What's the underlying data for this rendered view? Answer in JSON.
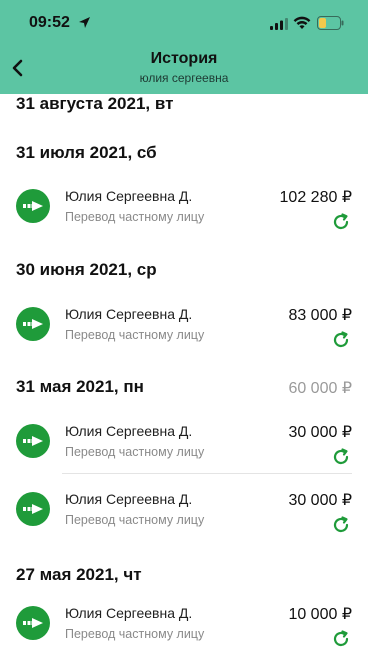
{
  "status_bar": {
    "time": "09:52"
  },
  "header": {
    "title": "История",
    "subtitle": "юлия сергеевна"
  },
  "top_date": "31 августа 2021, вт",
  "sections": [
    {
      "date": "31 июля 2021, сб",
      "total": "",
      "transactions": [
        {
          "name": "Юлия Сергеевна Д.",
          "description": "Перевод частному лицу",
          "amount": "102 280 ₽"
        }
      ]
    },
    {
      "date": "30 июня 2021, ср",
      "total": "",
      "transactions": [
        {
          "name": "Юлия Сергеевна Д.",
          "description": "Перевод частному лицу",
          "amount": "83 000 ₽"
        }
      ]
    },
    {
      "date": "31 мая 2021, пн",
      "total": "60 000 ₽",
      "transactions": [
        {
          "name": "Юлия Сергеевна Д.",
          "description": "Перевод частному лицу",
          "amount": "30 000 ₽"
        },
        {
          "name": "Юлия Сергеевна Д.",
          "description": "Перевод частному лицу",
          "amount": "30 000 ₽"
        }
      ]
    },
    {
      "date": "27 мая 2021, чт",
      "total": "",
      "transactions": [
        {
          "name": "Юлия Сергеевна Д.",
          "description": "Перевод частному лицу",
          "amount": "10 000 ₽"
        }
      ]
    }
  ],
  "colors": {
    "header_bg": "#5cc5a3",
    "icon_green": "#1f9b3a",
    "status_green": "#1f9b3a"
  }
}
